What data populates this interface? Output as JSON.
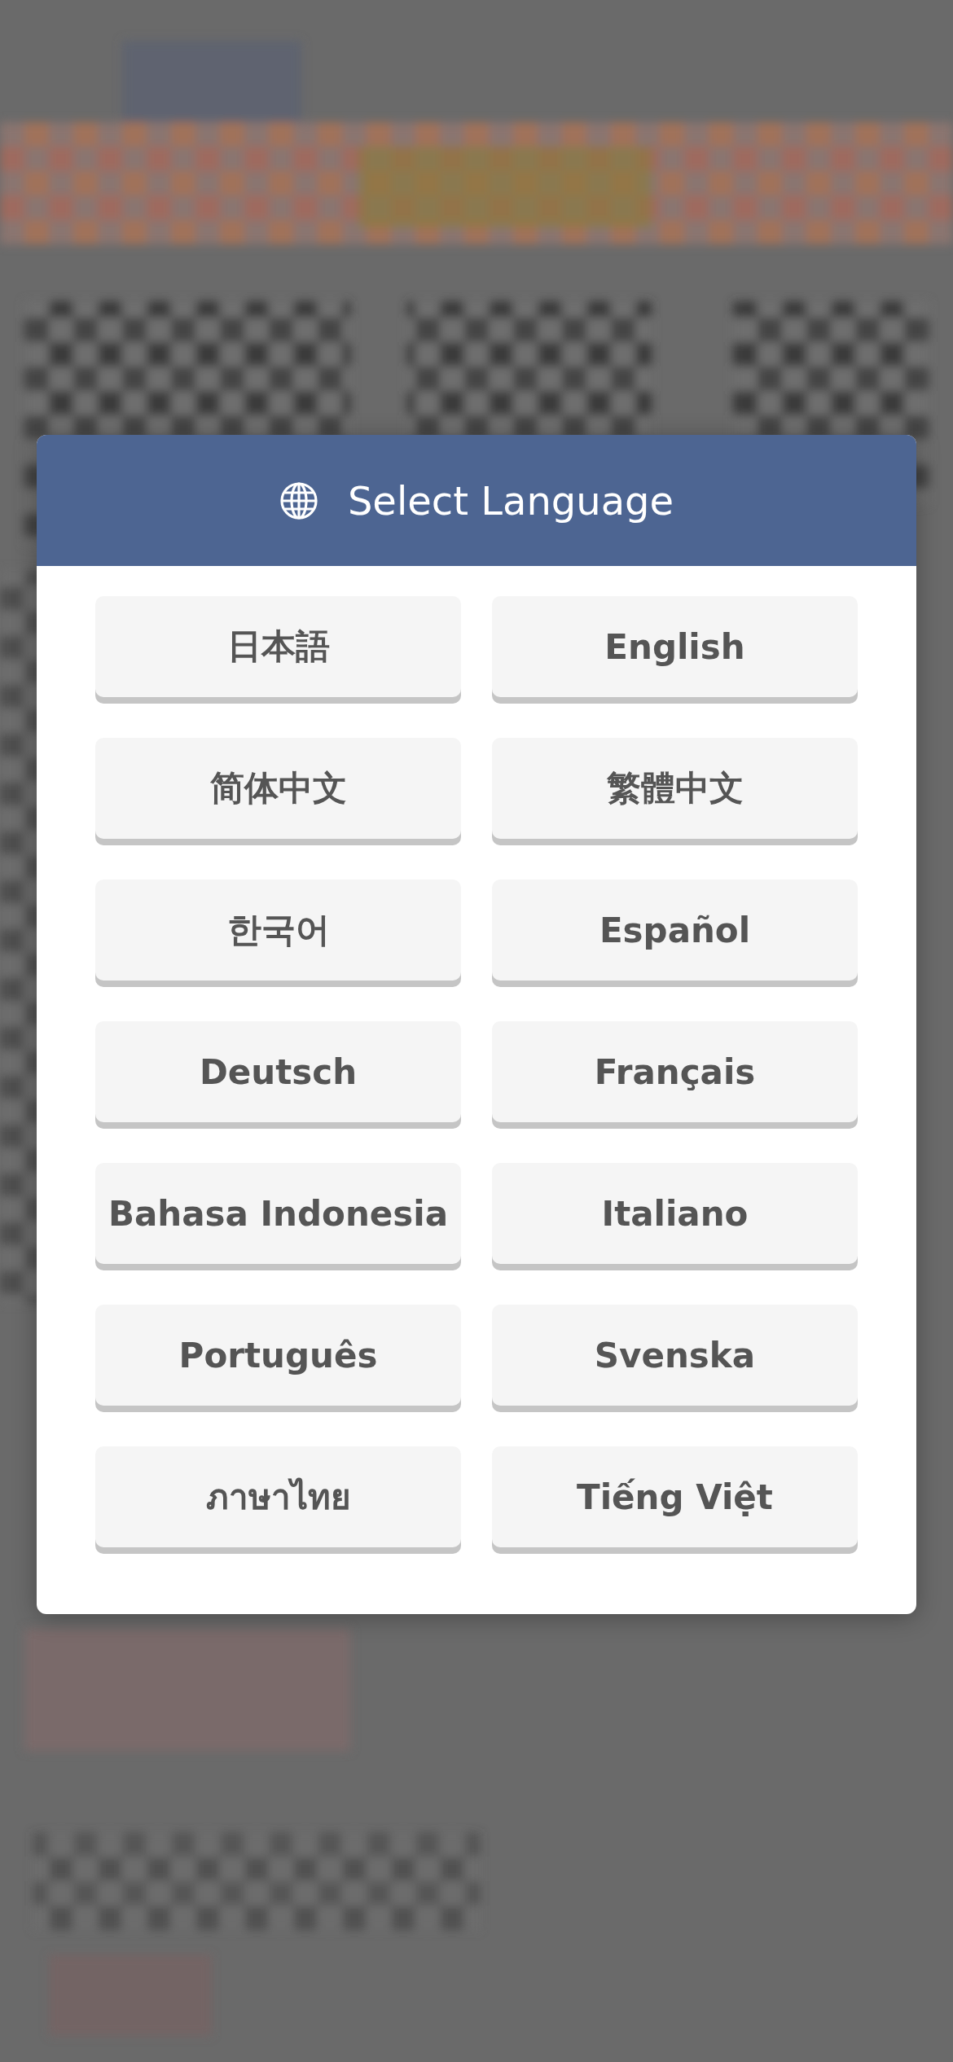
{
  "dialog": {
    "title": "Select Language",
    "languages": [
      {
        "label": "日本語"
      },
      {
        "label": "English"
      },
      {
        "label": "简体中文"
      },
      {
        "label": "繁體中文"
      },
      {
        "label": "한국어"
      },
      {
        "label": "Español"
      },
      {
        "label": "Deutsch"
      },
      {
        "label": "Français"
      },
      {
        "label": "Bahasa Indonesia"
      },
      {
        "label": "Italiano"
      },
      {
        "label": "Português"
      },
      {
        "label": "Svenska"
      },
      {
        "label": "ภาษาไทย"
      },
      {
        "label": "Tiếng Việt"
      }
    ]
  }
}
